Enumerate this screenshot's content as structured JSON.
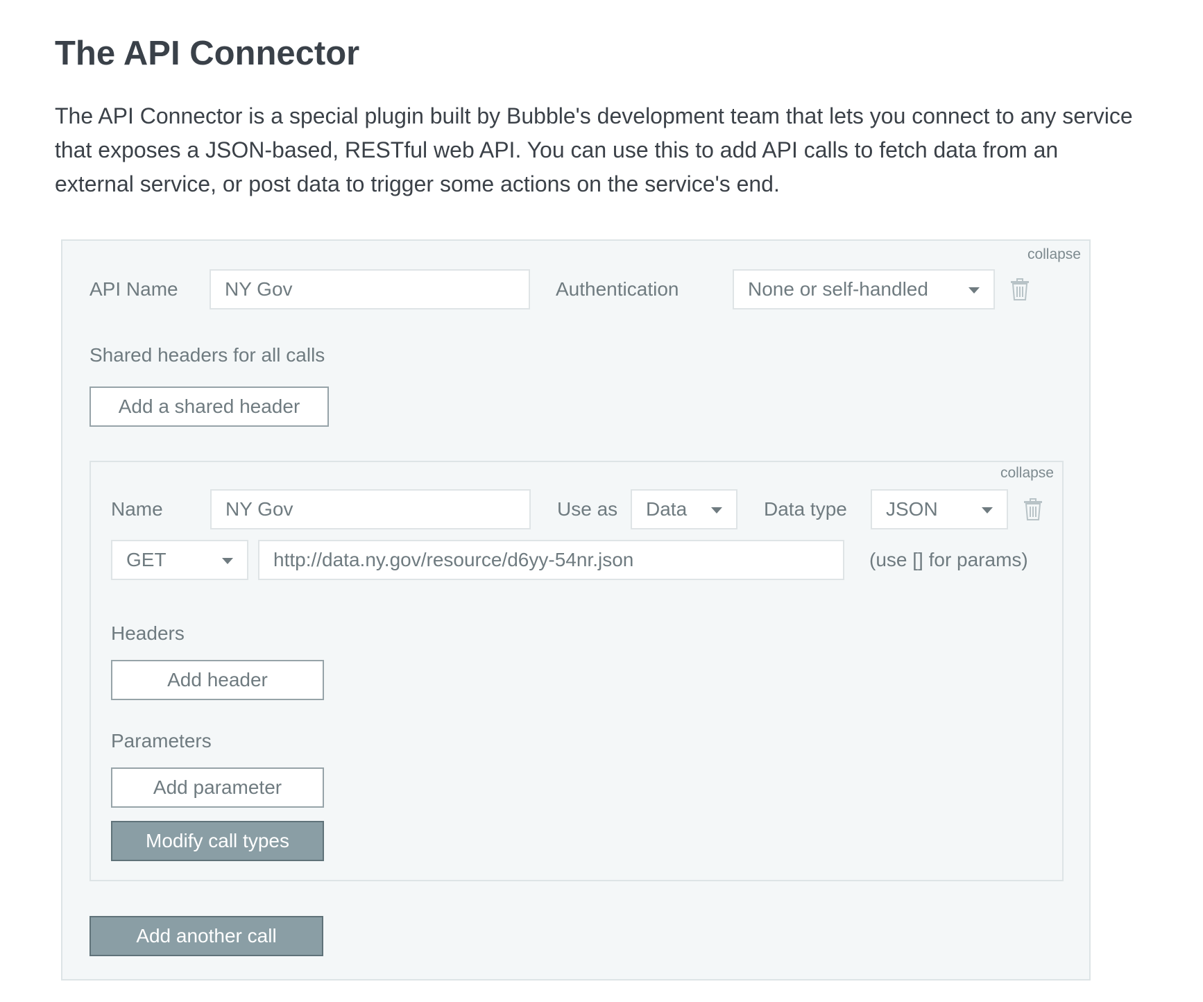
{
  "title": "The API Connector",
  "intro": "The API Connector is a special plugin built by Bubble's development team that lets you connect to any service that exposes a JSON-based, RESTful web API. You can use this to add API calls to fetch data from an external service, or post data to trigger some actions on the service's end.",
  "api": {
    "collapse_label": "collapse",
    "name_label": "API Name",
    "name_value": "NY Gov",
    "auth_label": "Authentication",
    "auth_value": "None or self-handled",
    "shared_headers_label": "Shared headers for all calls",
    "add_shared_header_label": "Add a shared header",
    "add_another_call_label": "Add another call"
  },
  "call": {
    "collapse_label": "collapse",
    "name_label": "Name",
    "name_value": "NY Gov",
    "use_as_label": "Use as",
    "use_as_value": "Data",
    "data_type_label": "Data type",
    "data_type_value": "JSON",
    "method_value": "GET",
    "url_value": "http://data.ny.gov/resource/d6yy-54nr.json",
    "params_hint": "(use [] for params)",
    "headers_label": "Headers",
    "add_header_label": "Add header",
    "parameters_label": "Parameters",
    "add_parameter_label": "Add parameter",
    "modify_call_types_label": "Modify call types"
  },
  "icons": {
    "delete": "trash-icon",
    "dropdown": "caret-down-icon"
  },
  "colors": {
    "panel_bg": "#f4f7f8",
    "filled_button": "#8a9ea5",
    "text": "#3b4148"
  }
}
